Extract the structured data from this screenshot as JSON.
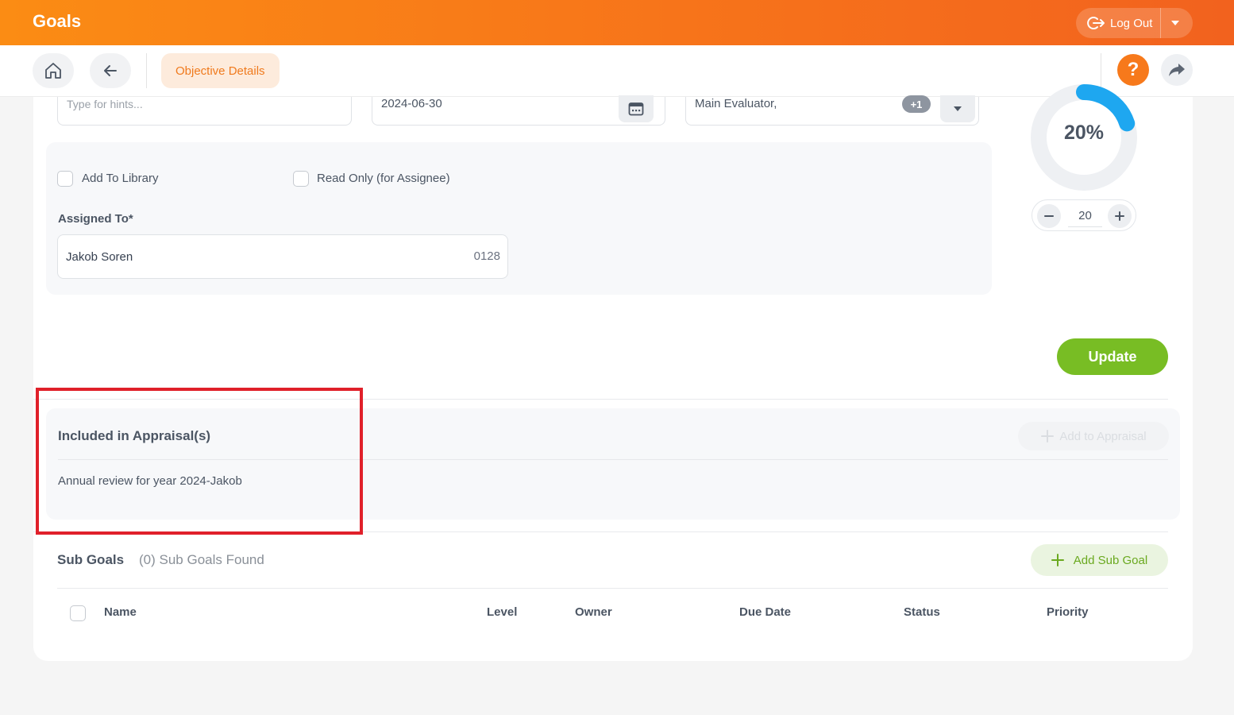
{
  "header": {
    "app_title": "Goals",
    "logout_label": "Log Out"
  },
  "toolbar": {
    "breadcrumb": "Objective Details",
    "help_glyph": "?"
  },
  "fields": {
    "hints_placeholder": "Type for hints...",
    "due_date": "2024-06-30",
    "evaluator": "Main Evaluator,",
    "evaluator_extra": "+1"
  },
  "options": {
    "add_to_library": "Add To Library",
    "read_only": "Read Only (for Assignee)"
  },
  "assigned": {
    "label": "Assigned To*",
    "name": "Jakob Soren",
    "id": "0128"
  },
  "progress": {
    "percent_label": "20%",
    "value": "20",
    "fraction": 0.2
  },
  "actions": {
    "update_label": "Update"
  },
  "appraisal": {
    "title": "Included in Appraisal(s)",
    "item": "Annual review for year 2024-Jakob",
    "add_label": "Add to Appraisal"
  },
  "sub_goals": {
    "title": "Sub Goals",
    "count_label": "(0) Sub Goals Found",
    "add_label": "Add Sub Goal",
    "columns": [
      "Name",
      "Level",
      "Owner",
      "Due Date",
      "Status",
      "Priority"
    ]
  },
  "colors": {
    "accent_orange": "#f7791b",
    "update_green": "#78bd24",
    "progress_blue": "#1ea7f0",
    "highlight_red": "#e0202a"
  }
}
